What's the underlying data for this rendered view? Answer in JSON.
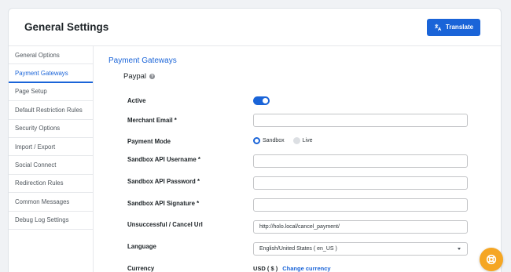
{
  "header": {
    "title": "General Settings",
    "translate_label": "Translate"
  },
  "sidebar": {
    "items": [
      {
        "label": "General Options"
      },
      {
        "label": "Payment Gateways",
        "active": true
      },
      {
        "label": "Page Setup"
      },
      {
        "label": "Default Restriction Rules"
      },
      {
        "label": "Security Options"
      },
      {
        "label": "Import / Export"
      },
      {
        "label": "Social Connect"
      },
      {
        "label": "Redirection Rules"
      },
      {
        "label": "Common Messages"
      },
      {
        "label": "Debug Log Settings"
      }
    ]
  },
  "main": {
    "section_title": "Payment Gateways",
    "gateway_title": "Paypal",
    "help_glyph": "?",
    "fields": {
      "active": {
        "label": "Active",
        "value": true
      },
      "merchant_email": {
        "label": "Merchant Email *",
        "value": ""
      },
      "payment_mode": {
        "label": "Payment Mode",
        "options": [
          "Sandbox",
          "Live"
        ],
        "selected": "Sandbox"
      },
      "sandbox_username": {
        "label": "Sandbox API Username *",
        "value": ""
      },
      "sandbox_password": {
        "label": "Sandbox API Password *",
        "value": ""
      },
      "sandbox_signature": {
        "label": "Sandbox API Signature *",
        "value": ""
      },
      "cancel_url": {
        "label": "Unsuccessful / Cancel Url",
        "value": "http://holo.local/cancel_payment/"
      },
      "language": {
        "label": "Language",
        "value": "English/United States ( en_US )"
      },
      "currency": {
        "label": "Currency",
        "value": "USD ( $ )",
        "link": "Change currency"
      }
    }
  },
  "colors": {
    "accent": "#1a64d8",
    "help_bubble": "#f5a623"
  },
  "icons": {
    "translate": "translate-icon",
    "help_bubble": "help-bubble-icon",
    "select_arrow": "chevron-down-icon"
  }
}
